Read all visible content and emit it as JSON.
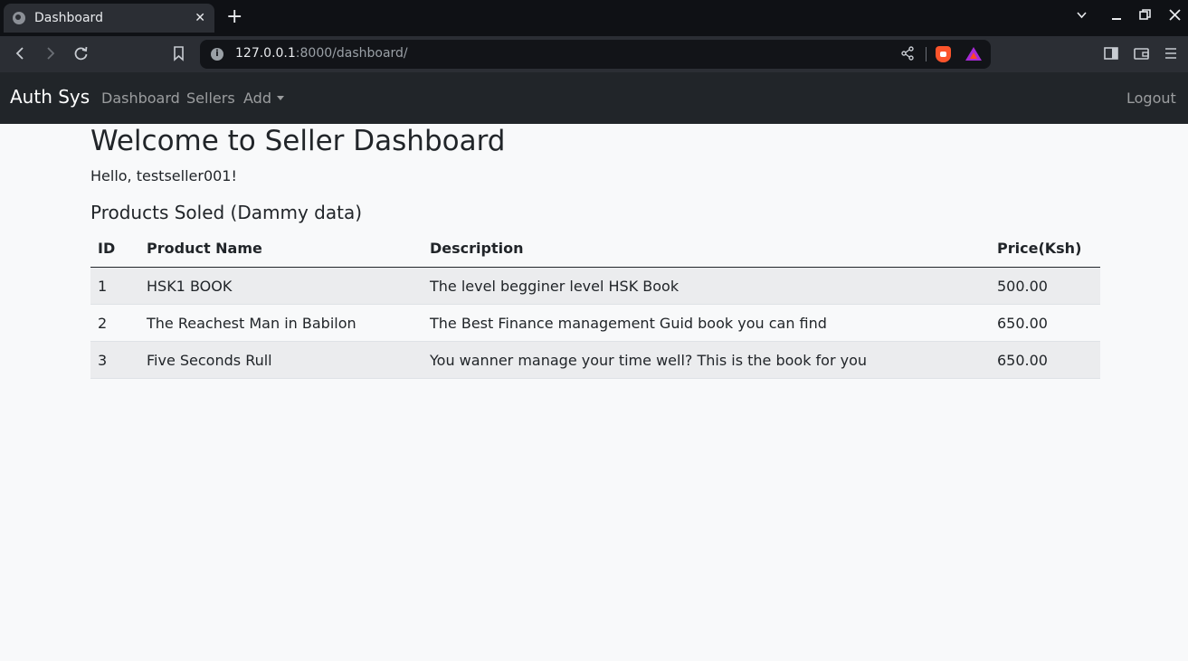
{
  "browser": {
    "tab_title": "Dashboard",
    "tab_close": "✕",
    "new_tab": "+",
    "url_host": "127.0.0.1",
    "url_rest": ":8000/dashboard/"
  },
  "navbar": {
    "brand": "Auth Sys",
    "links": [
      "Dashboard",
      "Sellers",
      "Add"
    ],
    "logout": "Logout"
  },
  "page": {
    "title": "Welcome to Seller Dashboard",
    "greeting": "Hello, testseller001!",
    "section_title": "Products Soled (Dammy data)"
  },
  "table": {
    "headers": [
      "ID",
      "Product Name",
      "Description",
      "Price(Ksh)"
    ],
    "rows": [
      [
        "1",
        "HSK1 BOOK",
        "The level begginer level HSK Book",
        "500.00"
      ],
      [
        "2",
        "The Reachest Man in Babilon",
        "The Best Finance management Guid book you can find",
        "650.00"
      ],
      [
        "3",
        "Five Seconds Rull",
        "You wanner manage your time well? This is the book for you",
        "650.00"
      ]
    ]
  },
  "colors": {
    "navbar_bg": "#212529",
    "page_bg": "#f8f9fa",
    "stripe_bg": "#ebecee"
  }
}
